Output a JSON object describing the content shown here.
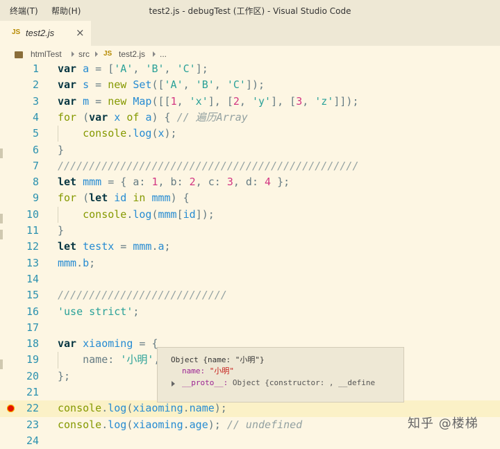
{
  "menubar": {
    "items": [
      "终端(T)",
      "帮助(H)"
    ]
  },
  "window": {
    "title": "test2.js - debugTest (工作区) - Visual Studio Code"
  },
  "tab": {
    "lang_badge": "JS",
    "name": "test2.js",
    "close_glyph": "×"
  },
  "breadcrumb": {
    "segments": [
      "htmlTest",
      "src",
      "test2.js",
      "..."
    ],
    "lang_badge": "JS"
  },
  "editor": {
    "lines": [
      {
        "n": "1"
      },
      {
        "n": "2"
      },
      {
        "n": "3"
      },
      {
        "n": "4"
      },
      {
        "n": "5"
      },
      {
        "n": "6"
      },
      {
        "n": "7"
      },
      {
        "n": "8"
      },
      {
        "n": "9"
      },
      {
        "n": "10"
      },
      {
        "n": "11"
      },
      {
        "n": "12"
      },
      {
        "n": "13"
      },
      {
        "n": "14"
      },
      {
        "n": "15"
      },
      {
        "n": "16"
      },
      {
        "n": "17"
      },
      {
        "n": "18"
      },
      {
        "n": "19"
      },
      {
        "n": "20"
      },
      {
        "n": "21"
      },
      {
        "n": "22"
      },
      {
        "n": "23"
      },
      {
        "n": "24"
      }
    ],
    "current_line": "22",
    "breakpoint_line": "22"
  },
  "hover": {
    "header": "Object {name: \"小明\"}",
    "name_key": "name: ",
    "name_value": "\"小明\"",
    "proto_key": "__proto__: ",
    "proto_value": "Object {constructor: , __define"
  },
  "watermark": "知乎 @楼梯",
  "colors": {
    "breakpoint": "#e51400",
    "current_line": "#fbf1c7",
    "background": "#fdf6e3"
  }
}
